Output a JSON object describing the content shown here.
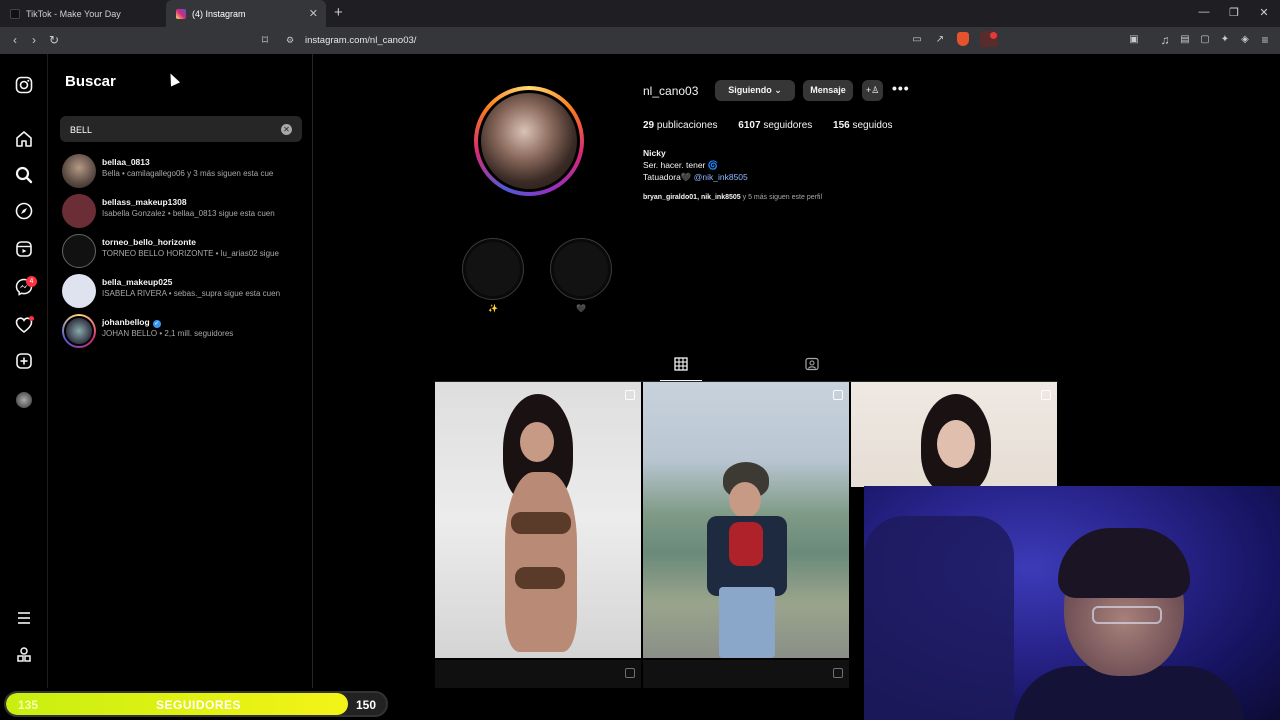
{
  "browser": {
    "tabs": [
      {
        "title": "TikTok - Make Your Day",
        "active": false
      },
      {
        "title": "(4) Instagram",
        "active": true
      }
    ],
    "url": "instagram.com/nl_cano03/"
  },
  "nav": {
    "notification_count": "4"
  },
  "search": {
    "title": "Buscar",
    "query": "BELL",
    "results": [
      {
        "username": "bellaa_0813",
        "subtitle": "Bella • camilagallego06 y 3 más siguen esta cue",
        "verified": false
      },
      {
        "username": "bellass_makeup1308",
        "subtitle": "Isabella Gonzalez • bellaa_0813 sigue esta cuen",
        "verified": false
      },
      {
        "username": "torneo_bello_horizonte",
        "subtitle": "TORNEO BELLO HORIZONTE • lu_arias02 sigue",
        "verified": false
      },
      {
        "username": "bella_makeup025",
        "subtitle": "ISABELA RIVERA • sebas._supra sigue esta cuen",
        "verified": false
      },
      {
        "username": "johanbellog",
        "subtitle": "JOHAN BELLO • 2,1 mill. seguidores",
        "verified": true
      }
    ]
  },
  "profile": {
    "username": "nl_cano03",
    "following_btn": "Siguiendo",
    "message_btn": "Mensaje",
    "posts_count": "29",
    "posts_label": "publicaciones",
    "followers_count": "6107",
    "followers_label": "seguidores",
    "following_count": "156",
    "following_label": "seguidos",
    "name": "Nicky",
    "bio_line1": "Ser. hacer. tener",
    "bio_line2": "Tatuadora🖤",
    "bio_link": "@nik_ink8505",
    "followed_by_names": "bryan_giraldo01, nik_ink8505",
    "followed_by_rest": "y 5 más siguen este perfil",
    "highlights": [
      {
        "label": "✨"
      },
      {
        "label": "🖤"
      }
    ]
  },
  "overlay": {
    "followers_current": "135",
    "followers_label": "SEGUIDORES",
    "followers_goal": "150",
    "progress": 0.9,
    "accent_color": "#e8f314"
  }
}
